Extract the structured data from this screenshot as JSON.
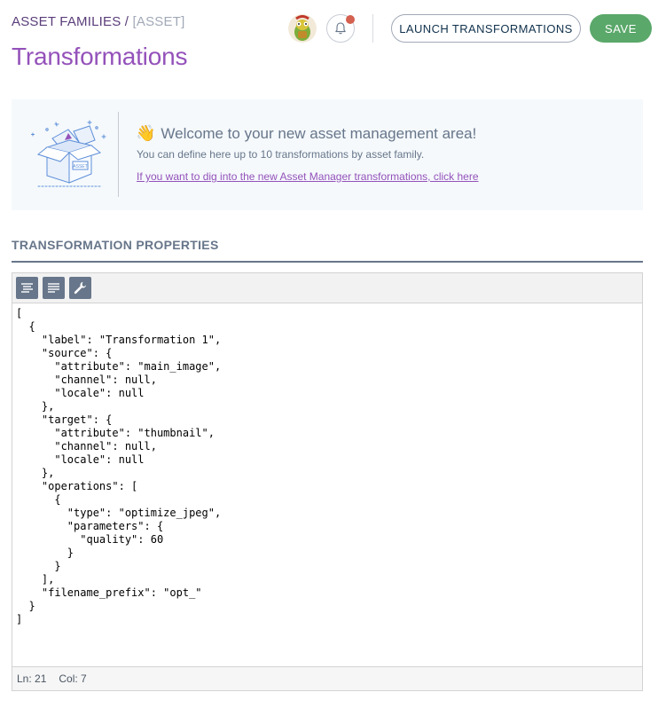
{
  "breadcrumb": {
    "parent": "ASSET FAMILIES",
    "separator": "/",
    "current": "[ASSET]"
  },
  "page_title": "Transformations",
  "header": {
    "launch_label": "LAUNCH TRANSFORMATIONS",
    "save_label": "SAVE"
  },
  "helper": {
    "emoji": "👋",
    "title": "Welcome to your new asset management area!",
    "description": "You can define here up to 10 transformations by asset family.",
    "link": "If you want to dig into the new Asset Manager transformations, click here",
    "illustration_label": "ASSET"
  },
  "section_title": "TRANSFORMATION PROPERTIES",
  "editor": {
    "content": "[\n  {\n    \"label\": \"Transformation 1\",\n    \"source\": {\n      \"attribute\": \"main_image\",\n      \"channel\": null,\n      \"locale\": null\n    },\n    \"target\": {\n      \"attribute\": \"thumbnail\",\n      \"channel\": null,\n      \"locale\": null\n    },\n    \"operations\": [\n      {\n        \"type\": \"optimize_jpeg\",\n        \"parameters\": {\n          \"quality\": 60\n        }\n      }\n    ],\n    \"filename_prefix\": \"opt_\"\n  }\n]",
    "status_line": "Ln: 21",
    "status_col": "Col: 7"
  },
  "colors": {
    "purple": "#9452ba",
    "green": "#5aa86a",
    "grey": "#67768a",
    "notification": "#d4604f"
  },
  "icons": [
    "avatar",
    "bell-icon",
    "format-icon",
    "compact-icon",
    "repair-icon"
  ]
}
